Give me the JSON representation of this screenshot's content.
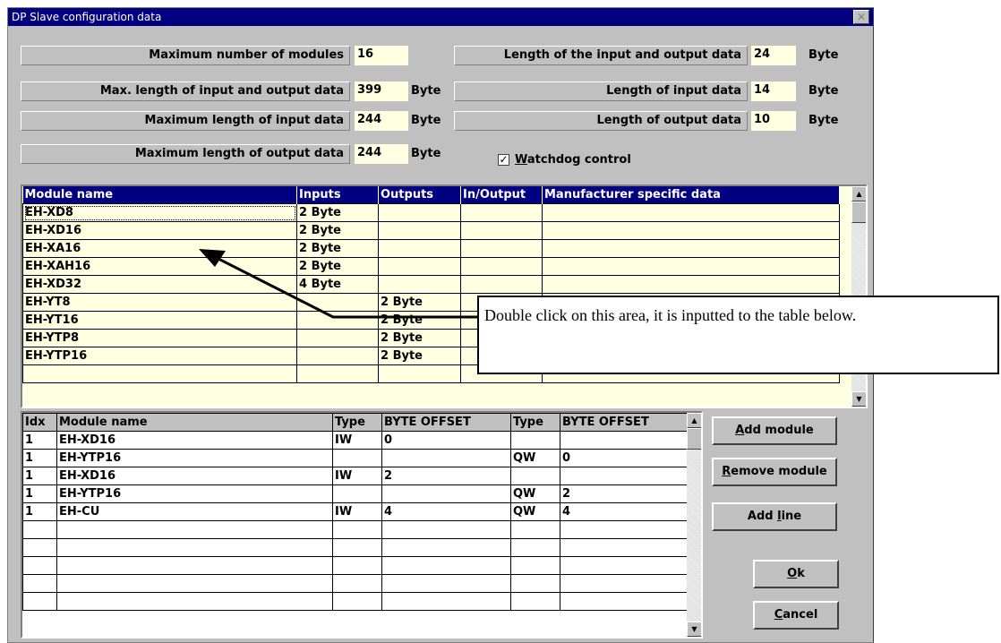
{
  "window": {
    "title": "DP Slave configuration data",
    "close_symbol": "✕"
  },
  "info": {
    "max_modules": {
      "label": "Maximum number of modules",
      "value": "16"
    },
    "max_io_len": {
      "label": "Max. length of input and output data",
      "value": "399",
      "unit": "Byte"
    },
    "max_in_len": {
      "label": "Maximum length of input data",
      "value": "244",
      "unit": "Byte"
    },
    "max_out_len": {
      "label": "Maximum length of output data",
      "value": "244",
      "unit": "Byte"
    },
    "io_len": {
      "label": "Length of the input and output data",
      "value": "24",
      "unit": "Byte"
    },
    "in_len": {
      "label": "Length of input data",
      "value": "14",
      "unit": "Byte"
    },
    "out_len": {
      "label": "Length of output data",
      "value": "10",
      "unit": "Byte"
    }
  },
  "watchdog": {
    "label_prefix": "W",
    "label_rest": "atchdog control",
    "checked": true,
    "check_symbol": "✓"
  },
  "module_table": {
    "headers": [
      "Module name",
      "Inputs",
      "Outputs",
      "In/Output",
      "Manufacturer specific data"
    ],
    "rows": [
      [
        "EH-XD8",
        "2 Byte",
        "",
        "",
        ""
      ],
      [
        "EH-XD16",
        "2 Byte",
        "",
        "",
        ""
      ],
      [
        "EH-XA16",
        "2 Byte",
        "",
        "",
        ""
      ],
      [
        "EH-XAH16",
        "2 Byte",
        "",
        "",
        ""
      ],
      [
        "EH-XD32",
        "4 Byte",
        "",
        "",
        ""
      ],
      [
        "EH-YT8",
        "",
        "2 Byte",
        "",
        ""
      ],
      [
        "EH-YT16",
        "",
        "2 Byte",
        "",
        ""
      ],
      [
        "EH-YTP8",
        "",
        "2 Byte",
        "",
        ""
      ],
      [
        "EH-YTP16",
        "",
        "2 Byte",
        "",
        ""
      ],
      [
        "",
        "",
        "",
        "",
        ""
      ]
    ]
  },
  "config_table": {
    "headers": [
      "Idx",
      "Module name",
      "Type",
      "BYTE OFFSET",
      "Type",
      "BYTE OFFSET"
    ],
    "rows": [
      [
        "1",
        "EH-XD16",
        "IW",
        "0",
        "",
        ""
      ],
      [
        "1",
        "EH-YTP16",
        "",
        "",
        "QW",
        "0"
      ],
      [
        "1",
        "EH-XD16",
        "IW",
        "2",
        "",
        ""
      ],
      [
        "1",
        "EH-YTP16",
        "",
        "",
        "QW",
        "2"
      ],
      [
        "1",
        "EH-CU",
        "IW",
        "4",
        "QW",
        "4"
      ],
      [
        "",
        "",
        "",
        "",
        "",
        ""
      ],
      [
        "",
        "",
        "",
        "",
        "",
        ""
      ],
      [
        "",
        "",
        "",
        "",
        "",
        ""
      ],
      [
        "",
        "",
        "",
        "",
        "",
        ""
      ],
      [
        "",
        "",
        "",
        "",
        "",
        ""
      ]
    ]
  },
  "buttons": {
    "add_module": {
      "mnemonic": "A",
      "rest": "dd module"
    },
    "remove_module": {
      "mnemonic": "R",
      "rest": "emove module"
    },
    "add_line": {
      "pre": "Add ",
      "mnemonic": "l",
      "rest": "ine"
    },
    "ok": {
      "mnemonic": "O",
      "rest": "k"
    },
    "cancel": {
      "mnemonic": "C",
      "rest": "ancel"
    }
  },
  "scroll": {
    "up": "▲",
    "down": "▼"
  },
  "callout": {
    "text": "Double click on this area, it is inputted to the table below."
  }
}
